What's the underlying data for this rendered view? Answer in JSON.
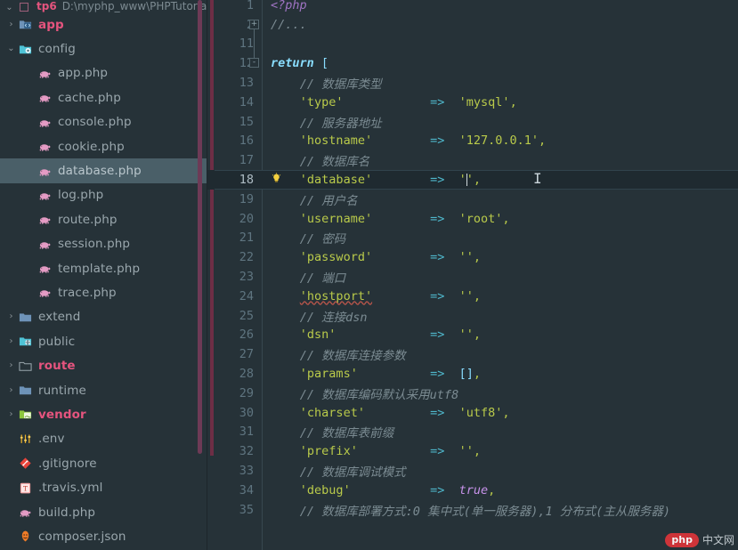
{
  "project": {
    "root_label": "tp6",
    "root_path": "D:\\myphp_www\\PHPTutorial\\W",
    "tree": [
      {
        "name": "app",
        "icon": "folder-code-icon",
        "type": "folder",
        "arrow": "›",
        "expanded": false,
        "style": "pink",
        "indent": 0
      },
      {
        "name": "config",
        "icon": "folder-gear-icon",
        "type": "folder",
        "arrow": "⌄",
        "expanded": true,
        "style": "muted",
        "indent": 0
      },
      {
        "name": "app.php",
        "icon": "php-file-icon",
        "type": "file",
        "arrow": "",
        "expanded": false,
        "style": "muted",
        "indent": 1
      },
      {
        "name": "cache.php",
        "icon": "php-file-icon",
        "type": "file",
        "arrow": "",
        "expanded": false,
        "style": "muted",
        "indent": 1
      },
      {
        "name": "console.php",
        "icon": "php-file-icon",
        "type": "file",
        "arrow": "",
        "expanded": false,
        "style": "muted",
        "indent": 1
      },
      {
        "name": "cookie.php",
        "icon": "php-file-icon",
        "type": "file",
        "arrow": "",
        "expanded": false,
        "style": "muted",
        "indent": 1
      },
      {
        "name": "database.php",
        "icon": "php-file-icon",
        "type": "file",
        "arrow": "",
        "expanded": false,
        "style": "sel",
        "indent": 1,
        "selected": true
      },
      {
        "name": "log.php",
        "icon": "php-file-icon",
        "type": "file",
        "arrow": "",
        "expanded": false,
        "style": "muted",
        "indent": 1
      },
      {
        "name": "route.php",
        "icon": "php-file-icon",
        "type": "file",
        "arrow": "",
        "expanded": false,
        "style": "muted",
        "indent": 1
      },
      {
        "name": "session.php",
        "icon": "php-file-icon",
        "type": "file",
        "arrow": "",
        "expanded": false,
        "style": "muted",
        "indent": 1
      },
      {
        "name": "template.php",
        "icon": "php-file-icon",
        "type": "file",
        "arrow": "",
        "expanded": false,
        "style": "muted",
        "indent": 1
      },
      {
        "name": "trace.php",
        "icon": "php-file-icon",
        "type": "file",
        "arrow": "",
        "expanded": false,
        "style": "muted",
        "indent": 1
      },
      {
        "name": "extend",
        "icon": "folder-icon",
        "type": "folder",
        "arrow": "›",
        "expanded": false,
        "style": "muted",
        "indent": 0
      },
      {
        "name": "public",
        "icon": "folder-web-icon",
        "type": "folder",
        "arrow": "›",
        "expanded": false,
        "style": "muted",
        "indent": 0
      },
      {
        "name": "route",
        "icon": "folder-outline-icon",
        "type": "folder",
        "arrow": "›",
        "expanded": false,
        "style": "pink",
        "indent": 0
      },
      {
        "name": "runtime",
        "icon": "folder-icon",
        "type": "folder",
        "arrow": "›",
        "expanded": false,
        "style": "muted",
        "indent": 0
      },
      {
        "name": "vendor",
        "icon": "folder-lib-icon",
        "type": "folder",
        "arrow": "›",
        "expanded": false,
        "style": "pink",
        "indent": 0
      },
      {
        "name": ".env",
        "icon": "settings-file-icon",
        "type": "file",
        "arrow": "",
        "expanded": false,
        "style": "muted",
        "indent": 0
      },
      {
        "name": ".gitignore",
        "icon": "git-file-icon",
        "type": "file",
        "arrow": "",
        "expanded": false,
        "style": "muted",
        "indent": 0
      },
      {
        "name": ".travis.yml",
        "icon": "yml-file-icon",
        "type": "file",
        "arrow": "",
        "expanded": false,
        "style": "muted",
        "indent": 0
      },
      {
        "name": "build.php",
        "icon": "php-file-icon",
        "type": "file",
        "arrow": "",
        "expanded": false,
        "style": "muted",
        "indent": 0
      },
      {
        "name": "composer.json",
        "icon": "composer-file-icon",
        "type": "file",
        "arrow": "",
        "expanded": false,
        "style": "muted",
        "indent": 0
      }
    ]
  },
  "editor": {
    "current_line": 18,
    "lines": [
      {
        "num": "1",
        "indent": 0,
        "tokens": [
          {
            "t": "<?php",
            "c": "t-tag"
          }
        ]
      },
      {
        "num": "2",
        "indent": 0,
        "fold": "+",
        "tokens": [
          {
            "t": "//...",
            "c": "t-cmt"
          }
        ]
      },
      {
        "num": "11",
        "indent": 0,
        "tokens": []
      },
      {
        "num": "12",
        "indent": 0,
        "fold": "-",
        "tokens": [
          {
            "t": "return ",
            "c": "t-kw"
          },
          {
            "t": "[",
            "c": "t-brk"
          }
        ]
      },
      {
        "num": "13",
        "indent": 4,
        "tokens": [
          {
            "t": "// 数据库类型",
            "c": "t-cmt"
          }
        ]
      },
      {
        "num": "14",
        "indent": 4,
        "tokens": [
          {
            "t": "'type'",
            "c": "t-str"
          },
          {
            "t": "            ",
            "c": ""
          },
          {
            "t": "=>",
            "c": "t-arrow"
          },
          {
            "t": "  ",
            "c": ""
          },
          {
            "t": "'mysql'",
            "c": "t-str"
          },
          {
            "t": ",",
            "c": "t-punc"
          }
        ]
      },
      {
        "num": "15",
        "indent": 4,
        "tokens": [
          {
            "t": "// 服务器地址",
            "c": "t-cmt"
          }
        ]
      },
      {
        "num": "16",
        "indent": 4,
        "tokens": [
          {
            "t": "'hostname'",
            "c": "t-str"
          },
          {
            "t": "        ",
            "c": ""
          },
          {
            "t": "=>",
            "c": "t-arrow"
          },
          {
            "t": "  ",
            "c": ""
          },
          {
            "t": "'127.0.0.1'",
            "c": "t-str"
          },
          {
            "t": ",",
            "c": "t-punc"
          }
        ]
      },
      {
        "num": "17",
        "indent": 4,
        "tokens": [
          {
            "t": "// 数据库名",
            "c": "t-cmt"
          }
        ]
      },
      {
        "num": "18",
        "indent": 4,
        "hint": "bulb-icon",
        "tokens": [
          {
            "t": "'database'",
            "c": "t-str"
          },
          {
            "t": "        ",
            "c": ""
          },
          {
            "t": "=>",
            "c": "t-arrow"
          },
          {
            "t": "  ",
            "c": ""
          },
          {
            "t": "''",
            "c": "t-str"
          },
          {
            "t": ",",
            "c": "t-punc"
          }
        ]
      },
      {
        "num": "19",
        "indent": 4,
        "tokens": [
          {
            "t": "// 用户名",
            "c": "t-cmt"
          }
        ]
      },
      {
        "num": "20",
        "indent": 4,
        "tokens": [
          {
            "t": "'username'",
            "c": "t-str"
          },
          {
            "t": "        ",
            "c": ""
          },
          {
            "t": "=>",
            "c": "t-arrow"
          },
          {
            "t": "  ",
            "c": ""
          },
          {
            "t": "'root'",
            "c": "t-str"
          },
          {
            "t": ",",
            "c": "t-punc"
          }
        ]
      },
      {
        "num": "21",
        "indent": 4,
        "tokens": [
          {
            "t": "// 密码",
            "c": "t-cmt"
          }
        ]
      },
      {
        "num": "22",
        "indent": 4,
        "tokens": [
          {
            "t": "'password'",
            "c": "t-str"
          },
          {
            "t": "        ",
            "c": ""
          },
          {
            "t": "=>",
            "c": "t-arrow"
          },
          {
            "t": "  ",
            "c": ""
          },
          {
            "t": "''",
            "c": "t-str"
          },
          {
            "t": ",",
            "c": "t-punc"
          }
        ]
      },
      {
        "num": "23",
        "indent": 4,
        "tokens": [
          {
            "t": "// 端口",
            "c": "t-cmt"
          }
        ]
      },
      {
        "num": "24",
        "indent": 4,
        "tokens": [
          {
            "t": "'hostport'",
            "c": "t-str typo"
          },
          {
            "t": "        ",
            "c": ""
          },
          {
            "t": "=>",
            "c": "t-arrow"
          },
          {
            "t": "  ",
            "c": ""
          },
          {
            "t": "''",
            "c": "t-str"
          },
          {
            "t": ",",
            "c": "t-punc"
          }
        ]
      },
      {
        "num": "25",
        "indent": 4,
        "tokens": [
          {
            "t": "// 连接dsn",
            "c": "t-cmt"
          }
        ]
      },
      {
        "num": "26",
        "indent": 4,
        "tokens": [
          {
            "t": "'dsn'",
            "c": "t-str"
          },
          {
            "t": "             ",
            "c": ""
          },
          {
            "t": "=>",
            "c": "t-arrow"
          },
          {
            "t": "  ",
            "c": ""
          },
          {
            "t": "''",
            "c": "t-str"
          },
          {
            "t": ",",
            "c": "t-punc"
          }
        ]
      },
      {
        "num": "27",
        "indent": 4,
        "tokens": [
          {
            "t": "// 数据库连接参数",
            "c": "t-cmt"
          }
        ]
      },
      {
        "num": "28",
        "indent": 4,
        "tokens": [
          {
            "t": "'params'",
            "c": "t-str"
          },
          {
            "t": "          ",
            "c": ""
          },
          {
            "t": "=>",
            "c": "t-arrow"
          },
          {
            "t": "  ",
            "c": ""
          },
          {
            "t": "[]",
            "c": "t-brk"
          },
          {
            "t": ",",
            "c": "t-punc"
          }
        ]
      },
      {
        "num": "29",
        "indent": 4,
        "tokens": [
          {
            "t": "// 数据库编码默认采用utf8",
            "c": "t-cmt"
          }
        ]
      },
      {
        "num": "30",
        "indent": 4,
        "tokens": [
          {
            "t": "'charset'",
            "c": "t-str"
          },
          {
            "t": "         ",
            "c": ""
          },
          {
            "t": "=>",
            "c": "t-arrow"
          },
          {
            "t": "  ",
            "c": ""
          },
          {
            "t": "'utf8'",
            "c": "t-str"
          },
          {
            "t": ",",
            "c": "t-punc"
          }
        ]
      },
      {
        "num": "31",
        "indent": 4,
        "tokens": [
          {
            "t": "// 数据库表前缀",
            "c": "t-cmt"
          }
        ]
      },
      {
        "num": "32",
        "indent": 4,
        "tokens": [
          {
            "t": "'prefix'",
            "c": "t-str"
          },
          {
            "t": "          ",
            "c": ""
          },
          {
            "t": "=>",
            "c": "t-arrow"
          },
          {
            "t": "  ",
            "c": ""
          },
          {
            "t": "''",
            "c": "t-str"
          },
          {
            "t": ",",
            "c": "t-punc"
          }
        ]
      },
      {
        "num": "33",
        "indent": 4,
        "tokens": [
          {
            "t": "// 数据库调试模式",
            "c": "t-cmt"
          }
        ]
      },
      {
        "num": "34",
        "indent": 4,
        "tokens": [
          {
            "t": "'debug'",
            "c": "t-str"
          },
          {
            "t": "           ",
            "c": ""
          },
          {
            "t": "=>",
            "c": "t-arrow"
          },
          {
            "t": "  ",
            "c": ""
          },
          {
            "t": "true",
            "c": "t-bool"
          },
          {
            "t": ",",
            "c": "t-punc"
          }
        ]
      },
      {
        "num": "35",
        "indent": 4,
        "tokens": [
          {
            "t": "// 数据库部署方式:0 集中式(单一服务器),1 分布式(主从服务器)",
            "c": "t-cmt"
          }
        ]
      }
    ]
  },
  "watermark": {
    "badge": "php",
    "text": "中文网"
  },
  "colors": {
    "background": "#263238",
    "selection": "#4a5f68",
    "current_line": "#1f2a30",
    "accent_pink": "#e5547e",
    "string": "#b9ca4a",
    "comment": "#7b8b92",
    "keyword": "#89ddff",
    "boolean": "#c792ea",
    "scrollbar": "#6d3a56"
  }
}
